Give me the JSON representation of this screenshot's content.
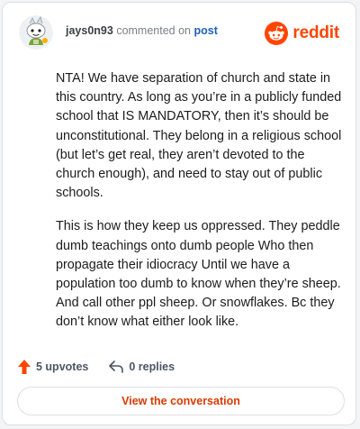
{
  "header": {
    "username": "jays0n93",
    "action_text": "commented on",
    "post_link": "post",
    "brand_name": "reddit",
    "avatar_icon": "snoo-avatar-icon",
    "brand_icon": "reddit-snoo-icon"
  },
  "comment": {
    "paragraphs": [
      "NTA! We have separation of church and state in this country. As long as you’re in a publicly funded school that IS MANDATORY, then it’s should be unconstitutional. They belong in a religious school (but let’s get real, they aren’t devoted to the church enough), and need to stay out of public schools.",
      "This is how they keep us oppressed. They peddle dumb teachings onto dumb people Who then propagate their idiocracy Until we have a population too dumb to know when they’re sheep. And call other ppl sheep. Or snowflakes. Bc they don’t know what either look like."
    ]
  },
  "actions": {
    "upvotes_label": "5 upvotes",
    "replies_label": "0 replies",
    "upvote_icon": "upvote-arrow-icon",
    "reply_icon": "reply-arrow-icon"
  },
  "cta": {
    "label": "View the conversation"
  },
  "colors": {
    "brand": "#ff4500",
    "link": "#1f5fbf",
    "cta_text": "#d93a00",
    "upvote": "#ff4500"
  }
}
